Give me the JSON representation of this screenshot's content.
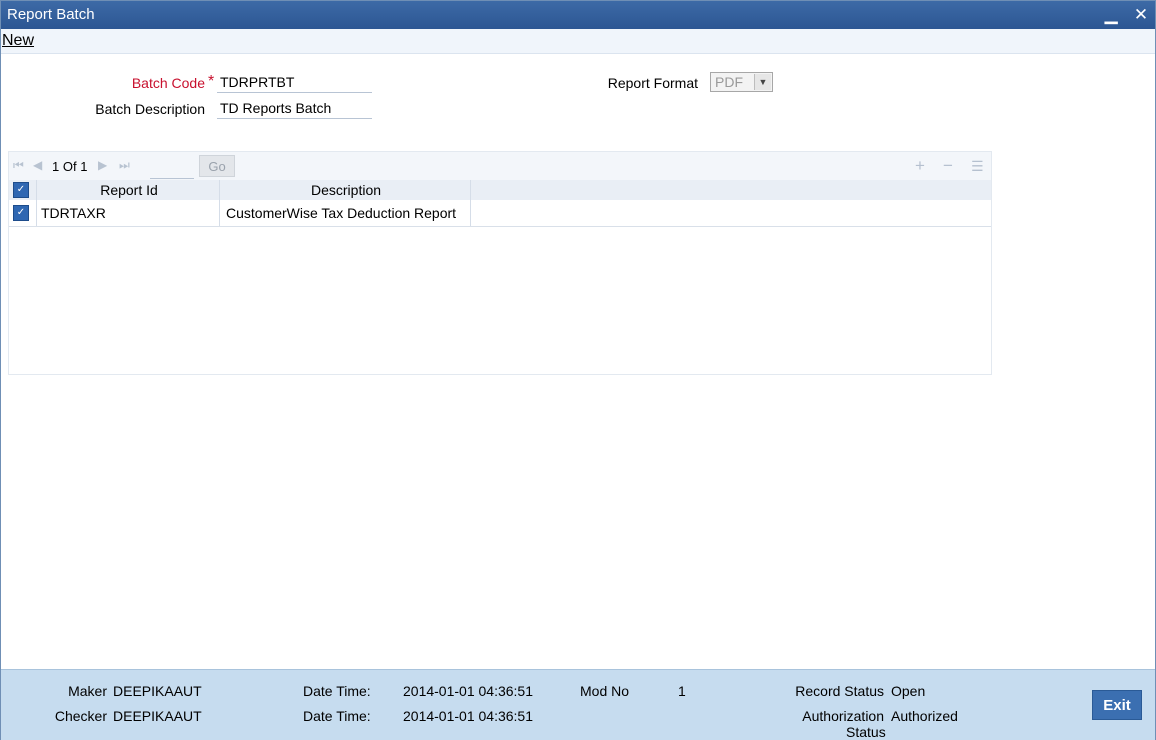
{
  "window": {
    "title": "Report Batch",
    "minimize_icon": "minimize-icon",
    "close_icon": "close-icon"
  },
  "menu": {
    "new_label": "New"
  },
  "form": {
    "batch_code_label": "Batch Code",
    "required_mark": "*",
    "batch_code_value": "TDRPRTBT",
    "batch_description_label": "Batch Description",
    "batch_description_value": "TD Reports Batch",
    "report_format_label": "Report Format",
    "report_format_value": "PDF"
  },
  "grid": {
    "pager": {
      "current": "1",
      "of_label": "Of",
      "total": "1",
      "go_label": "Go"
    },
    "columns": [
      "Report Id",
      "Description"
    ],
    "rows": [
      {
        "report_id": "TDRTAXR",
        "description": "CustomerWise Tax Deduction Report"
      }
    ]
  },
  "footer": {
    "maker_label": "Maker",
    "maker_value": "DEEPIKAAUT",
    "checker_label": "Checker",
    "checker_value": "DEEPIKAAUT",
    "date_time_label": "Date Time:",
    "maker_date": "2014-01-01 04:36:51",
    "checker_date": "2014-01-01 04:36:51",
    "mod_no_label": "Mod No",
    "mod_no_value": "1",
    "record_status_label": "Record Status",
    "record_status_value": "Open",
    "auth_status_label_1": "Authorization",
    "auth_status_label_2": "Status",
    "auth_status_value": "Authorized",
    "exit_label": "Exit"
  },
  "colors": {
    "titlebar": "#2c5693",
    "required": "#c8102e",
    "footer_bg": "#c6dcef",
    "exit_button": "#3b6fb1"
  }
}
